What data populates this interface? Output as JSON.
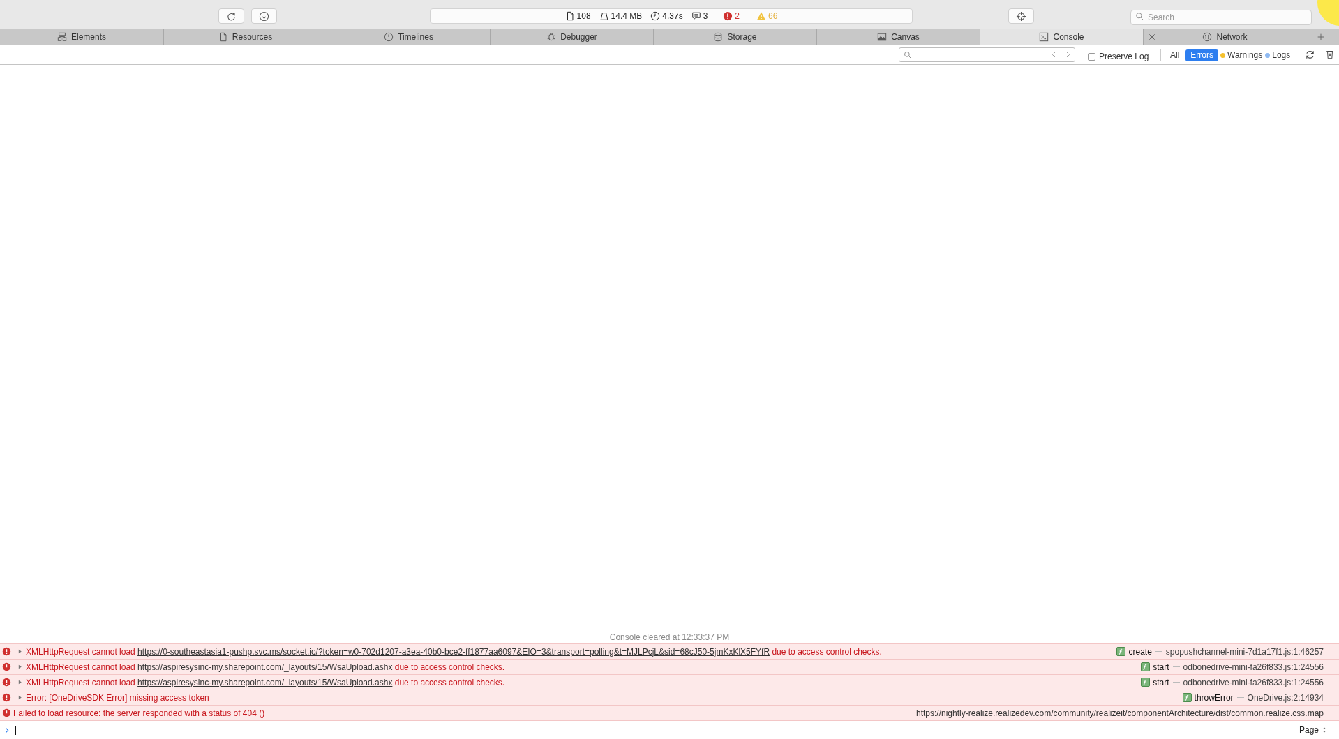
{
  "toolbar": {
    "buttons": [
      {
        "kind": "reload"
      },
      {
        "kind": "download"
      }
    ],
    "status": [
      {
        "kind": "resources",
        "text": "108"
      },
      {
        "kind": "size",
        "text": "14.4 MB"
      },
      {
        "kind": "time",
        "text": "4.37s"
      },
      {
        "kind": "logs",
        "text": "3"
      },
      {
        "kind": "errors",
        "text": "2"
      },
      {
        "kind": "warnings",
        "text": "66"
      }
    ],
    "search": {
      "placeholder": "Search"
    }
  },
  "tabs": [
    {
      "label": "Elements",
      "kind": "elements",
      "selected": false,
      "closable": false
    },
    {
      "label": "Resources",
      "kind": "resources",
      "selected": false,
      "closable": false
    },
    {
      "label": "Timelines",
      "kind": "timelines",
      "selected": false,
      "closable": false
    },
    {
      "label": "Debugger",
      "kind": "debugger",
      "selected": false,
      "closable": false
    },
    {
      "label": "Storage",
      "kind": "storage",
      "selected": false,
      "closable": false
    },
    {
      "label": "Canvas",
      "kind": "canvas",
      "selected": false,
      "closable": false
    },
    {
      "label": "Console",
      "kind": "console",
      "selected": true,
      "closable": false
    },
    {
      "label": "Network",
      "kind": "network",
      "selected": false,
      "closable": true
    }
  ],
  "filter_bar": {
    "preserve_log": {
      "label": "Preserve Log",
      "checked": false
    },
    "levels": [
      {
        "label": "All",
        "selected": false
      },
      {
        "label": "Errors",
        "selected": true
      },
      {
        "label": "Warnings",
        "selected": false,
        "color": "#f5c12e"
      },
      {
        "label": "Logs",
        "selected": false,
        "color": "#8fbaf2"
      }
    ]
  },
  "console": {
    "cleared": "Console cleared at 12:33:37 PM",
    "messages": [
      {
        "expandable": true,
        "prefix": "XMLHttpRequest cannot load ",
        "url": "https://0-southeastasia1-pushp.svc.ms/socket.io/?token=w0-702d1207-a3ea-40b0-bce2-ff1877aa6097&EIO=3&transport=polling&t=MJLPcjL&sid=68cJ50-5jmKxKlX5FYfR",
        "suffix": " due to access control checks.",
        "function": "create",
        "location": "spopushchannel-mini-7d1a17f1.js:1:46257"
      },
      {
        "expandable": true,
        "prefix": "XMLHttpRequest cannot load ",
        "url": "https://aspiresysinc-my.sharepoint.com/_layouts/15/WsaUpload.ashx",
        "suffix": " due to access control checks.",
        "function": "start",
        "location": "odbonedrive-mini-fa26f833.js:1:24556"
      },
      {
        "expandable": true,
        "prefix": "XMLHttpRequest cannot load ",
        "url": "https://aspiresysinc-my.sharepoint.com/_layouts/15/WsaUpload.ashx",
        "suffix": " due to access control checks.",
        "function": "start",
        "location": "odbonedrive-mini-fa26f833.js:1:24556"
      },
      {
        "expandable": true,
        "prefix": "Error: [OneDriveSDK Error] missing access token",
        "function": "throwError",
        "location": "OneDrive.js:2:14934"
      },
      {
        "expandable": false,
        "prefix": "Failed to load resource: the server responded with a status of 404 ()",
        "link": "https://nightly-realize.realizedev.com/community/realizeit/componentArchitecture/dist/common.realize.css.map"
      }
    ]
  },
  "prompt": {
    "context": "Page"
  }
}
